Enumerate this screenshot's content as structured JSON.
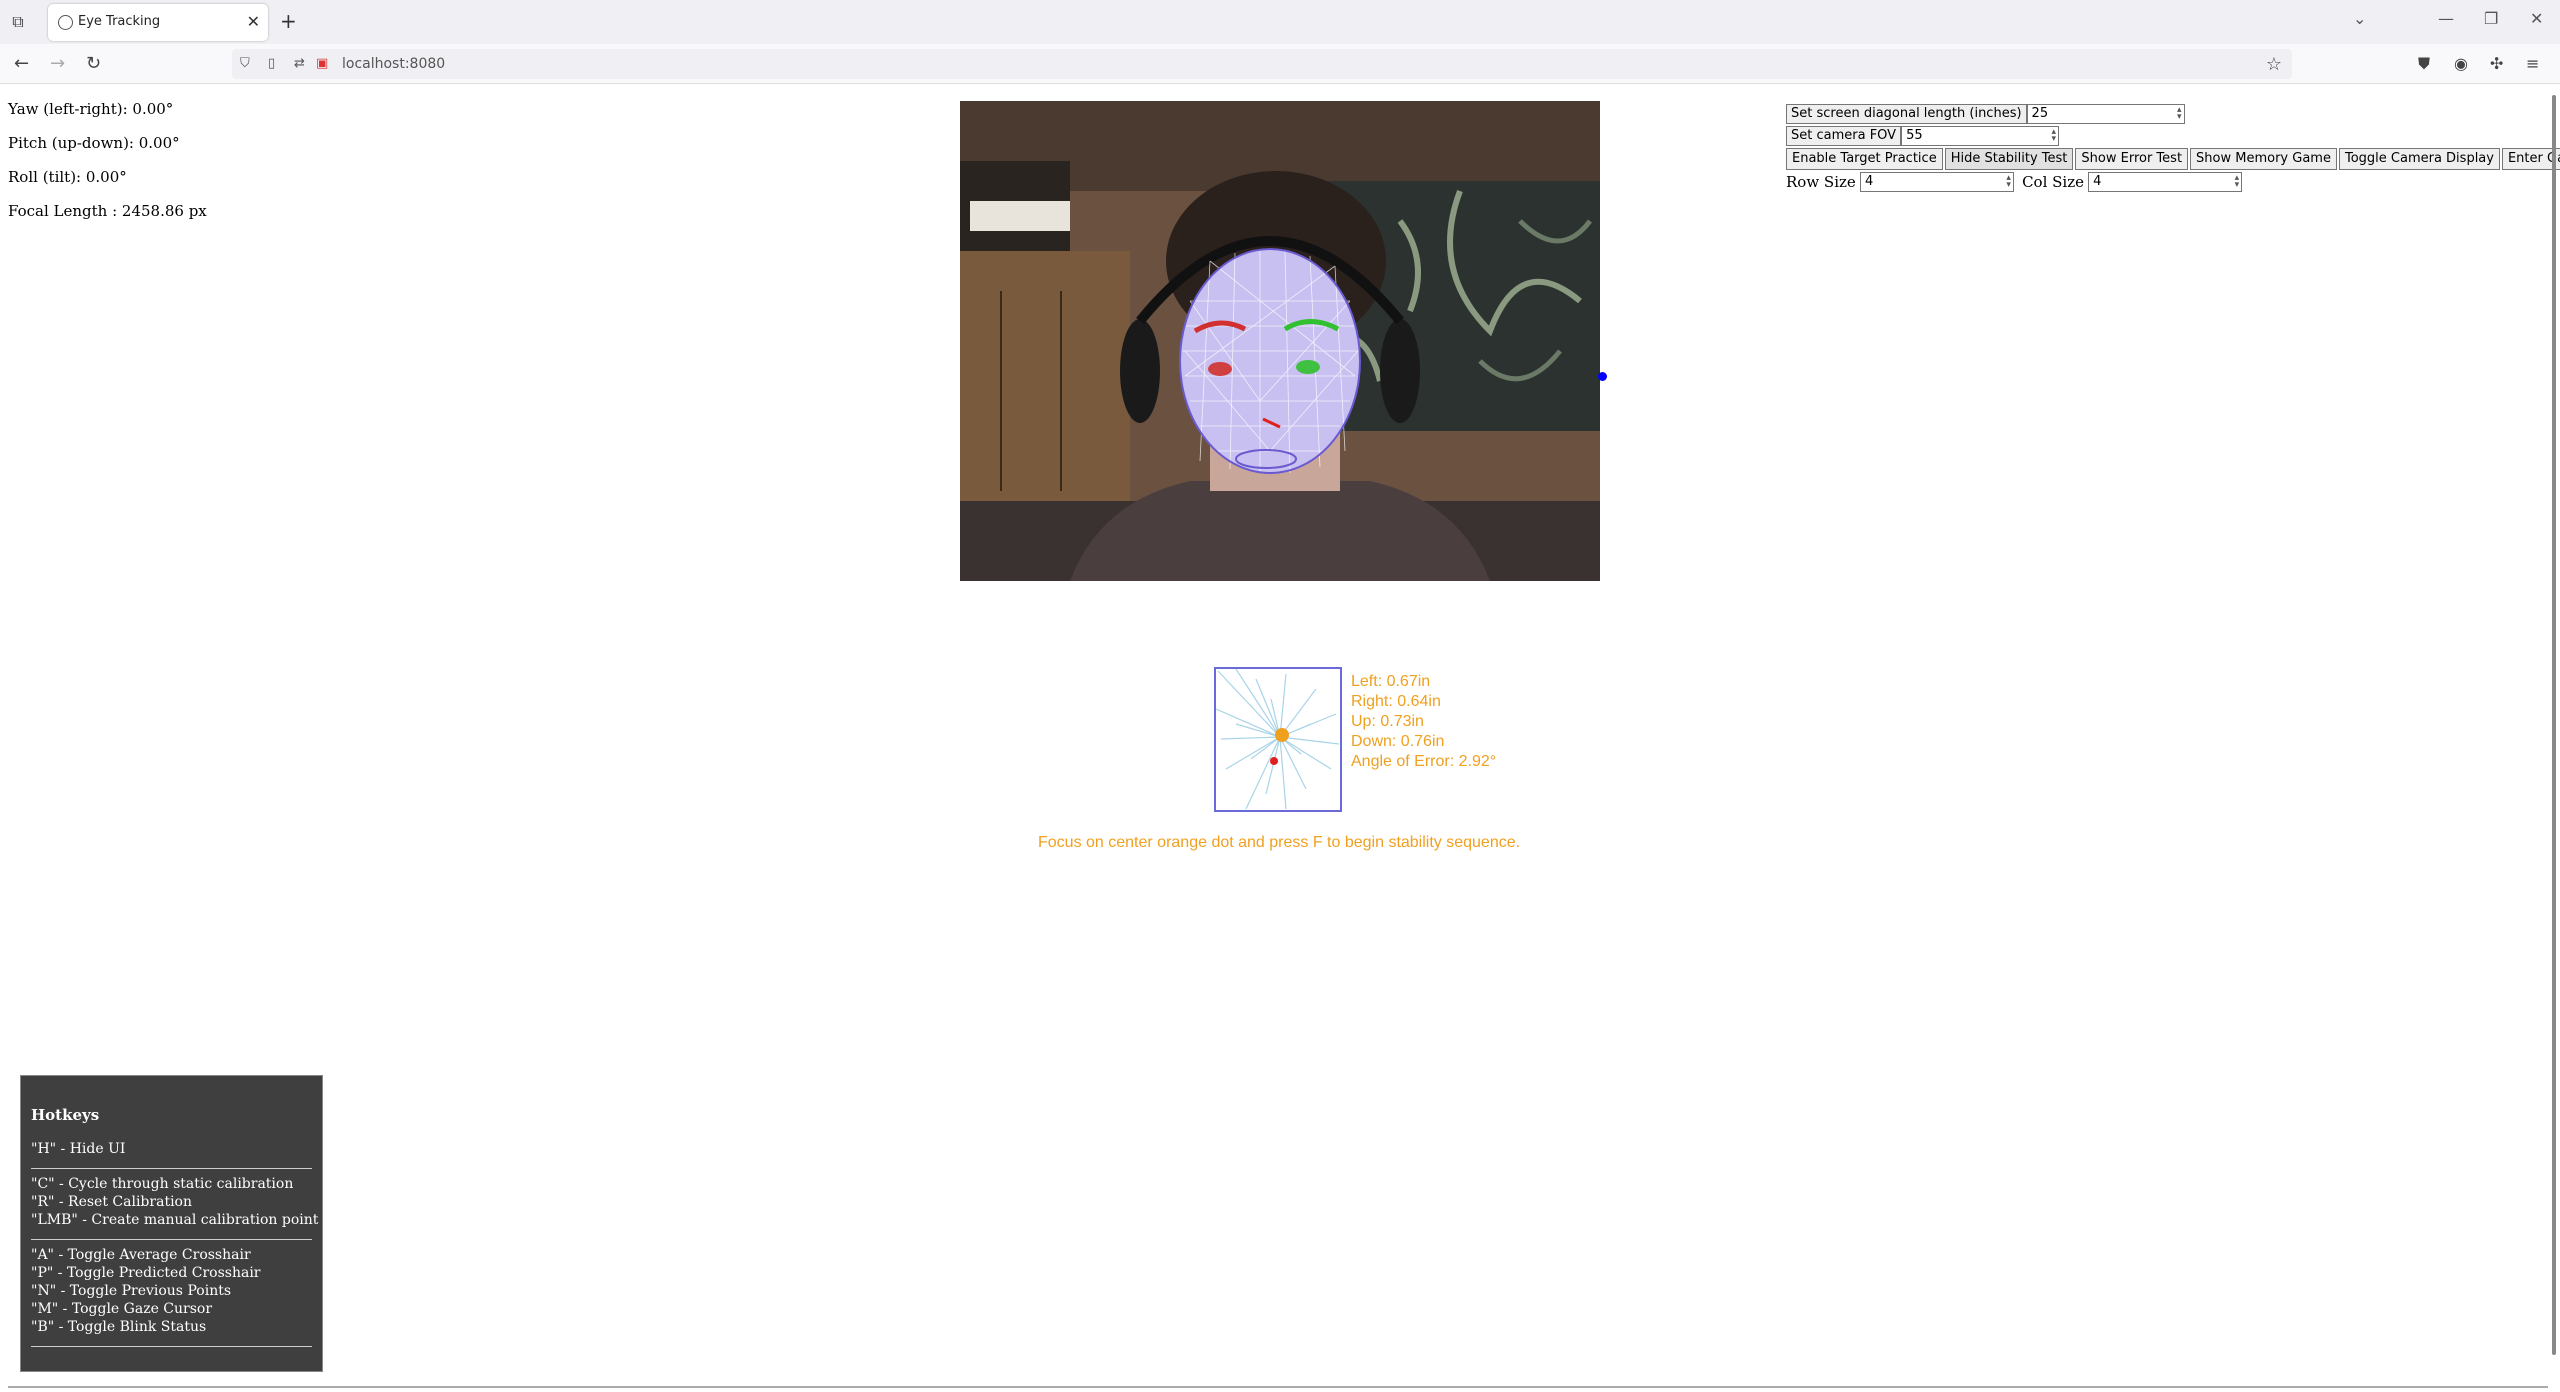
{
  "browser": {
    "tab_title": "Eye Tracking",
    "url": "localhost:8080",
    "new_tab": "+",
    "close": "✕"
  },
  "readouts": {
    "yaw": "Yaw (left-right): 0.00°",
    "pitch": "Pitch (up-down): 0.00°",
    "roll": "Roll (tilt): 0.00°",
    "focal": "Focal Length : 2458.86 px"
  },
  "controls": {
    "screen_diag_label": "Set screen diagonal length (inches)",
    "screen_diag_value": "25",
    "fov_label": "Set camera FOV",
    "fov_value": "55",
    "buttons": [
      "Enable Target Practice",
      "Hide Stability Test",
      "Show Error Test",
      "Show Memory Game",
      "Toggle Camera Display",
      "Enter Gaze Tracing"
    ],
    "row_size_label": "Row Size",
    "row_size_value": "4",
    "col_size_label": "Col Size",
    "col_size_value": "4"
  },
  "stability": {
    "left": "Left: 0.67in",
    "right": "Right: 0.64in",
    "up": "Up: 0.73in",
    "down": "Down: 0.76in",
    "angle": "Angle of Error: 2.92°",
    "message": "Focus on center orange dot and press F to begin stability sequence."
  },
  "hotkeys": {
    "title": "Hotkeys",
    "group1": [
      "\"H\" - Hide UI"
    ],
    "group2": [
      "\"C\" - Cycle through static calibration",
      "\"R\" - Reset Calibration",
      "\"LMB\" - Create manual calibration point"
    ],
    "group3": [
      "\"A\" - Toggle Average Crosshair",
      "\"P\" - Toggle Predicted Crosshair",
      "\"N\" - Toggle Previous Points",
      "\"M\" - Toggle Gaze Cursor",
      "\"B\" - Toggle Blink Status"
    ]
  },
  "colors": {
    "accent_orange": "#f0a020",
    "mesh": "#d8d8ff",
    "marker_blue": "#0000ff",
    "hotkey_bg": "#3f3f3f"
  }
}
